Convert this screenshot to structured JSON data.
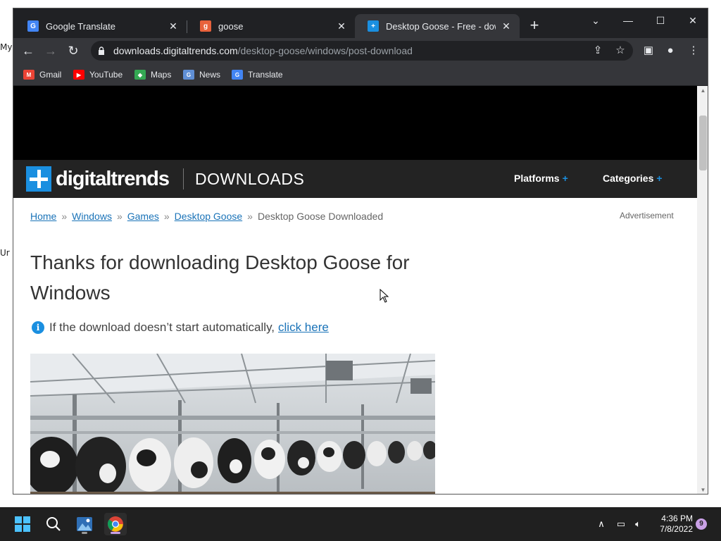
{
  "desktop": {
    "fragments": [
      "My",
      "Ur"
    ]
  },
  "tabs": [
    {
      "title": "Google Translate",
      "favicon": "google-translate-icon",
      "color": "#4285f4"
    },
    {
      "title": "goose",
      "favicon": "goose-icon",
      "color": "#e8623c"
    },
    {
      "title": "Desktop Goose - Free - download",
      "favicon": "digitaltrends-icon",
      "color": "#1a8fe0",
      "active": true
    }
  ],
  "toolbar": {
    "url_host": "downloads.digitaltrends.com",
    "url_path": "/desktop-goose/windows/post-download"
  },
  "bookmarks": [
    {
      "label": "Gmail",
      "icon": "gmail-icon",
      "color": "#ea4335"
    },
    {
      "label": "YouTube",
      "icon": "youtube-icon",
      "color": "#ff0000"
    },
    {
      "label": "Maps",
      "icon": "maps-icon",
      "color": "#34a853"
    },
    {
      "label": "News",
      "icon": "news-icon",
      "color": "#4285f4"
    },
    {
      "label": "Translate",
      "icon": "translate-icon",
      "color": "#4285f4"
    }
  ],
  "site": {
    "logo": "digitaltrends",
    "section": "DOWNLOADS",
    "nav": [
      "Platforms",
      "Categories"
    ],
    "nav_plus": "+",
    "accent": "#1a8fe0"
  },
  "breadcrumb": {
    "links": [
      "Home",
      "Windows",
      "Games",
      "Desktop Goose"
    ],
    "current": "Desktop Goose Downloaded",
    "separator": "»"
  },
  "ad_label": "Advertisement",
  "headline": "Thanks for downloading Desktop Goose for Windows",
  "notice": {
    "text": "If the download doesn’t start automatically,",
    "link": "click here"
  },
  "taskbar": {
    "time": "4:36 PM",
    "date": "7/8/2022",
    "notifications": "9"
  }
}
